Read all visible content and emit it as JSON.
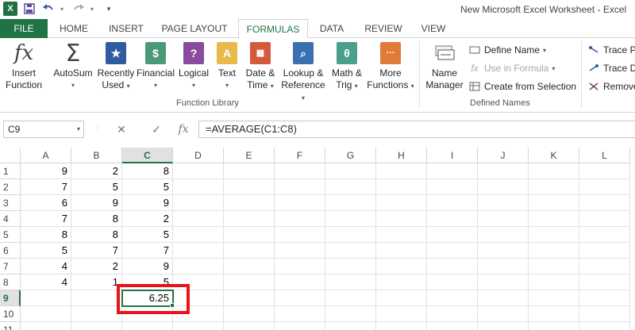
{
  "app": {
    "title": "New Microsoft Excel Worksheet - Excel",
    "logo": "X"
  },
  "tabs": [
    "FILE",
    "HOME",
    "INSERT",
    "PAGE LAYOUT",
    "FORMULAS",
    "DATA",
    "REVIEW",
    "VIEW"
  ],
  "active_tab": "FORMULAS",
  "ribbon": {
    "function_library": {
      "label": "Function Library",
      "buttons": [
        {
          "line1": "Insert",
          "line2": "Function",
          "icon": "fx-icon"
        },
        {
          "line1": "AutoSum",
          "line2": "",
          "icon": "sigma-icon"
        },
        {
          "line1": "Recently",
          "line2": "Used",
          "icon": "star-book-icon"
        },
        {
          "line1": "Financial",
          "line2": "",
          "icon": "money-book-icon"
        },
        {
          "line1": "Logical",
          "line2": "",
          "icon": "question-book-icon"
        },
        {
          "line1": "Text",
          "line2": "",
          "icon": "text-book-icon"
        },
        {
          "line1": "Date &",
          "line2": "Time",
          "icon": "calendar-book-icon"
        },
        {
          "line1": "Lookup &",
          "line2": "Reference",
          "icon": "lookup-book-icon"
        },
        {
          "line1": "Math &",
          "line2": "Trig",
          "icon": "theta-book-icon"
        },
        {
          "line1": "More",
          "line2": "Functions",
          "icon": "more-book-icon"
        }
      ]
    },
    "defined_names": {
      "label": "Defined Names",
      "name_manager_line1": "Name",
      "name_manager_line2": "Manager",
      "define_name": "Define Name",
      "use_in_formula": "Use in Formula",
      "create_from_selection": "Create from Selection"
    },
    "auditing": {
      "trace_precedents": "Trace P",
      "trace_dependents": "Trace D",
      "remove_arrows": "Remove"
    }
  },
  "formula_bar": {
    "name_box": "C9",
    "cancel_icon": "✕",
    "enter_icon": "✓",
    "fx_label": "fx",
    "formula": "=AVERAGE(C1:C8)"
  },
  "columns": [
    "A",
    "B",
    "C",
    "D",
    "E",
    "F",
    "G",
    "H",
    "I",
    "J",
    "K",
    "L"
  ],
  "rows": [
    "1",
    "2",
    "3",
    "4",
    "5",
    "6",
    "7",
    "8",
    "9",
    "10",
    "11"
  ],
  "cells": {
    "A": [
      "9",
      "7",
      "6",
      "7",
      "8",
      "5",
      "4",
      "4",
      "",
      "",
      ""
    ],
    "B": [
      "2",
      "5",
      "9",
      "8",
      "8",
      "7",
      "2",
      "1",
      "",
      "",
      ""
    ],
    "C": [
      "8",
      "5",
      "9",
      "2",
      "5",
      "7",
      "9",
      "5",
      "6.25",
      "",
      ""
    ]
  },
  "selected_cell": "C9",
  "colors": {
    "excel_green": "#217346",
    "highlight_red": "#e8141c"
  }
}
